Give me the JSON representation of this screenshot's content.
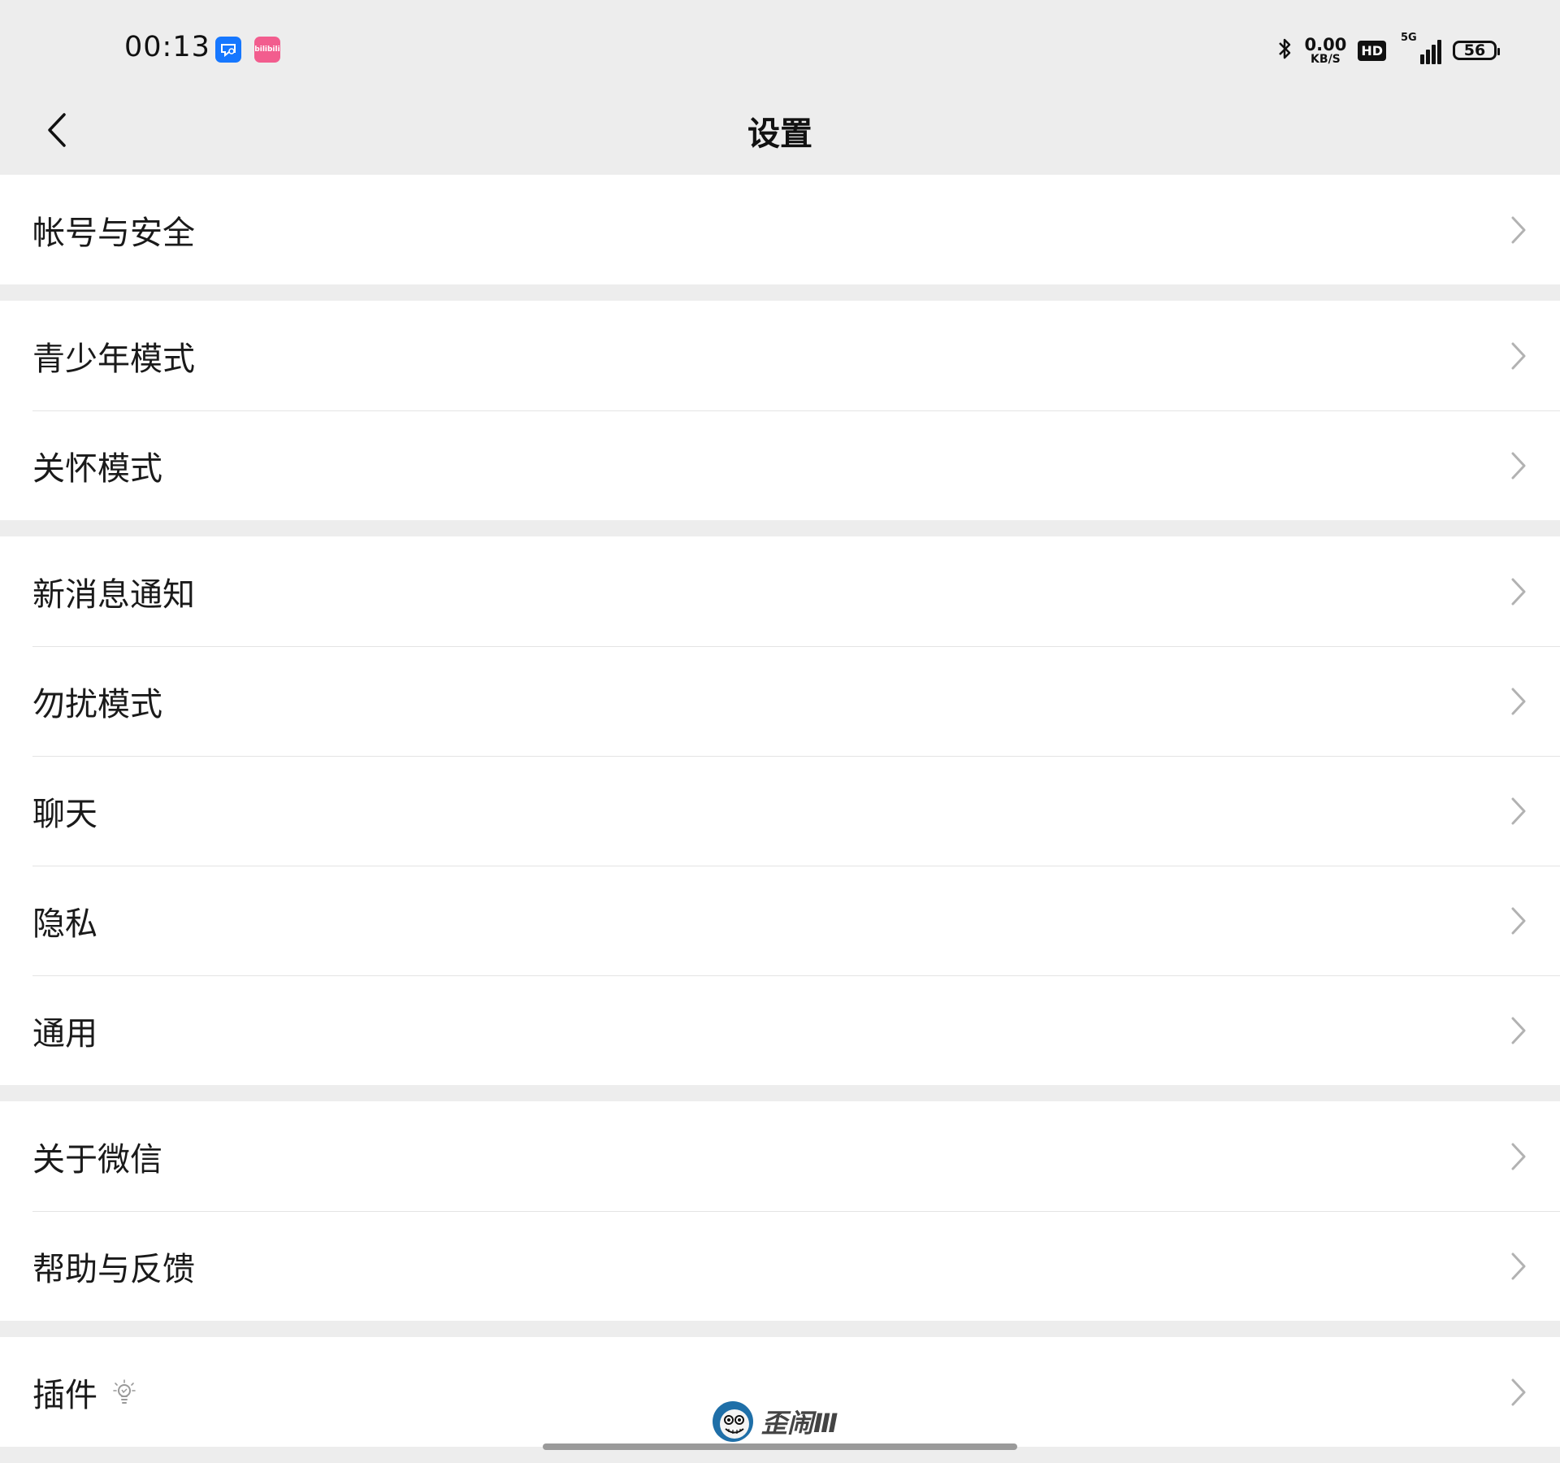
{
  "status_bar": {
    "time": "00:13",
    "app_badges": [
      {
        "icon": "message-app-icon",
        "color": "#1677ff"
      },
      {
        "icon": "bilibili-app-icon",
        "color": "#f25d8e",
        "label": "bilibili"
      }
    ],
    "bluetooth_icon": "bluetooth-icon",
    "net_speed_value": "0.00",
    "net_speed_unit": "KB/S",
    "hd_label": "HD",
    "network_label": "5G",
    "battery_level": "56"
  },
  "header": {
    "title": "设置",
    "back_icon": "chevron-left-icon"
  },
  "groups": [
    {
      "items": [
        {
          "label": "帐号与安全"
        }
      ]
    },
    {
      "items": [
        {
          "label": "青少年模式"
        },
        {
          "label": "关怀模式"
        }
      ]
    },
    {
      "items": [
        {
          "label": "新消息通知"
        },
        {
          "label": "勿扰模式"
        },
        {
          "label": "聊天"
        },
        {
          "label": "隐私"
        },
        {
          "label": "通用"
        }
      ]
    },
    {
      "items": [
        {
          "label": "关于微信"
        },
        {
          "label": "帮助与反馈"
        }
      ]
    },
    {
      "items": [
        {
          "label": "插件",
          "extra_icon": "lightbulb-icon"
        }
      ]
    }
  ],
  "watermark": {
    "text": "歪闹Ⅲ",
    "icon": "mascot-face-icon"
  },
  "colors": {
    "background": "#ededed",
    "card": "#ffffff",
    "divider": "#e4e4e4",
    "chevron": "#b2b2b2"
  }
}
